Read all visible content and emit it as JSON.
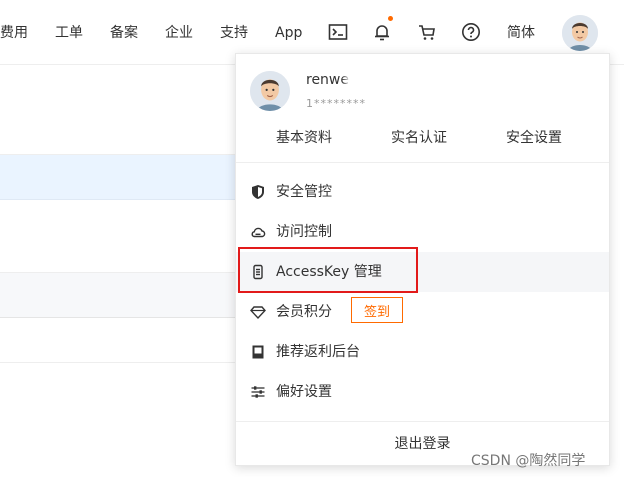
{
  "nav": {
    "items": [
      "费用",
      "工单",
      "备案",
      "企业",
      "支持",
      "App",
      "简体"
    ],
    "icons": [
      "terminal-icon",
      "bell-icon",
      "cart-icon",
      "help-icon"
    ]
  },
  "profile": {
    "username": "renwe",
    "account_id": "1********",
    "tabs": [
      "基本资料",
      "实名认证",
      "安全设置"
    ]
  },
  "menu": {
    "items": [
      {
        "label": "安全管控",
        "icon": "shield-icon"
      },
      {
        "label": "访问控制",
        "icon": "cloud-icon"
      },
      {
        "label": "AccessKey 管理",
        "icon": "key-icon"
      },
      {
        "label": "会员积分",
        "icon": "diamond-icon"
      },
      {
        "label": "推荐返利后台",
        "icon": "bookmark-icon"
      },
      {
        "label": "偏好设置",
        "icon": "sliders-icon"
      }
    ],
    "checkin_label": "签到",
    "logout_label": "退出登录"
  },
  "colors": {
    "accent": "#ff6a00",
    "highlight_border": "#e21a1a",
    "hover_bg": "#f5f6f8",
    "selected_row_bg": "#eaf4ff"
  },
  "watermark": "CSDN @陶然同学"
}
